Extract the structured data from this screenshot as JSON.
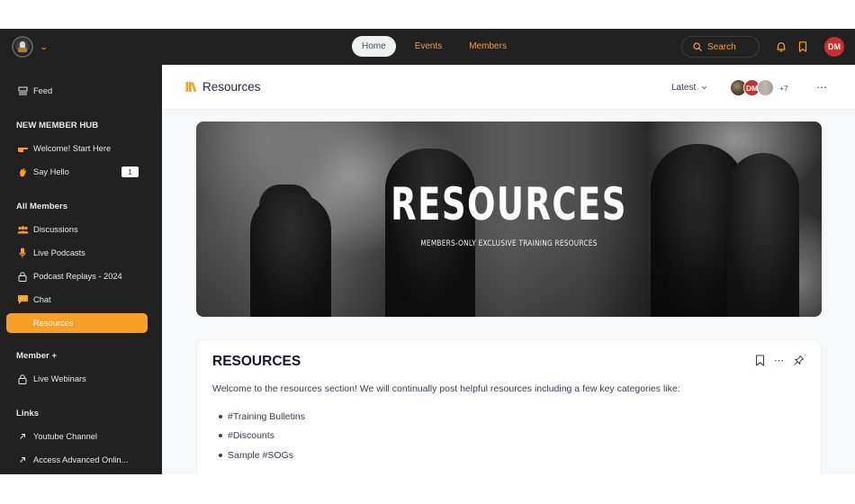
{
  "topbar": {
    "nav": [
      {
        "label": "Home",
        "active": true
      },
      {
        "label": "Events",
        "active": false
      },
      {
        "label": "Members",
        "active": false
      }
    ],
    "search_label": "Search",
    "user_initials": "DM"
  },
  "sidebar": {
    "feed": {
      "label": "Feed",
      "icon": "feed-icon"
    },
    "sections": [
      {
        "heading": "NEW MEMBER HUB",
        "items": [
          {
            "label": "Welcome! Start Here",
            "icon": "pointing-hand-icon"
          },
          {
            "label": "Say Hello",
            "icon": "waving-hand-icon",
            "badge": "1"
          }
        ]
      },
      {
        "heading": "All Members",
        "items": [
          {
            "label": "Discussions",
            "icon": "people-icon"
          },
          {
            "label": "Live Podcasts",
            "icon": "microphone-icon"
          },
          {
            "label": "Podcast Replays - 2024",
            "icon": "lock-icon"
          },
          {
            "label": "Chat",
            "icon": "chat-bubble-icon"
          },
          {
            "label": "Resources",
            "icon": "none",
            "active": true
          }
        ]
      },
      {
        "heading": "Member +",
        "items": [
          {
            "label": "Live Webinars",
            "icon": "lock-icon"
          }
        ]
      },
      {
        "heading": "Links",
        "items": [
          {
            "label": "Youtube Channel",
            "icon": "external-arrow-icon"
          },
          {
            "label": "Access Advanced Onlin...",
            "icon": "external-arrow-icon"
          }
        ]
      }
    ]
  },
  "content_header": {
    "title": "Resources",
    "sort_label": "Latest",
    "member_avatar_initials": "DM",
    "member_extra_count": "+7"
  },
  "banner": {
    "title": "RESOURCES",
    "subtitle": "MEMBERS-ONLY EXCLUSIVE TRAINING RESOURCES"
  },
  "post": {
    "title": "RESOURCES",
    "body": "Welcome to the resources section! We will continually post helpful resources including a few key categories like:",
    "list": [
      "#Training Bulletins",
      "#Discounts",
      "Sample #SOGs"
    ]
  },
  "colors": {
    "accent": "#f7a028",
    "topbar_bg": "#212121",
    "sidebar_bg": "#212121",
    "avatar_red": "#c9302c"
  }
}
